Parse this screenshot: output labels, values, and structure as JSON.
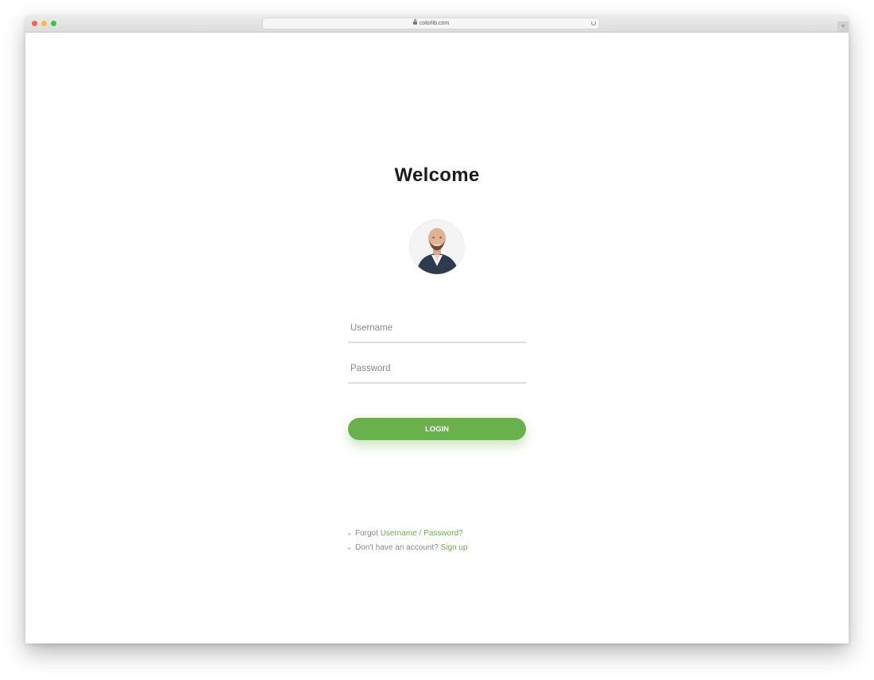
{
  "browser": {
    "url": "colorlib.com",
    "new_tab_label": "+"
  },
  "page": {
    "title": "Welcome",
    "username_placeholder": "Username",
    "password_placeholder": "Password",
    "login_label": "LOGIN",
    "forgot_prefix": "Forgot",
    "forgot_link": "Username / Password?",
    "signup_prefix": "Don't have an account?",
    "signup_link": "Sign up"
  },
  "colors": {
    "accent": "#6ab04c",
    "text_muted": "#888888",
    "title": "#1c1c1c"
  },
  "icons": {
    "lock": "lock-icon",
    "reload": "reload-icon",
    "avatar": "user-avatar-photo"
  }
}
